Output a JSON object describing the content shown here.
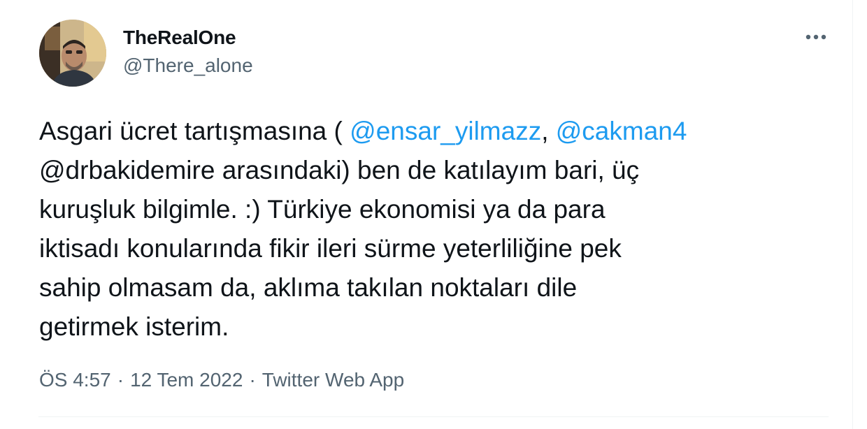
{
  "author": {
    "display_name": "TheRealOne",
    "handle": "@There_alone"
  },
  "tweet": {
    "line1": {
      "before": "Asgari ücret tartışmasına ( ",
      "mention1": "@ensar_yilmazz",
      "between": ", ",
      "mention2": "@cakman4"
    },
    "line2": "@drbakidemire arasındaki) ben de katılayım bari, üç",
    "line3": "kuruşluk bilgimle. :) Türkiye ekonomisi ya da para",
    "line4": "iktisadı konularında fikir ileri sürme yeterliliğine pek",
    "line5": "sahip olmasam da, aklıma takılan noktaları dile",
    "line6": "getirmek isterim."
  },
  "meta": {
    "time": "ÖS 4:57",
    "separator": "·",
    "date": "12 Tem 2022",
    "source": "Twitter Web App"
  },
  "icons": {
    "more": "more-horizontal-icon"
  },
  "colors": {
    "link": "#1d9bf0",
    "text": "#0f1419",
    "secondary": "#536471",
    "border": "#eff3f4"
  }
}
